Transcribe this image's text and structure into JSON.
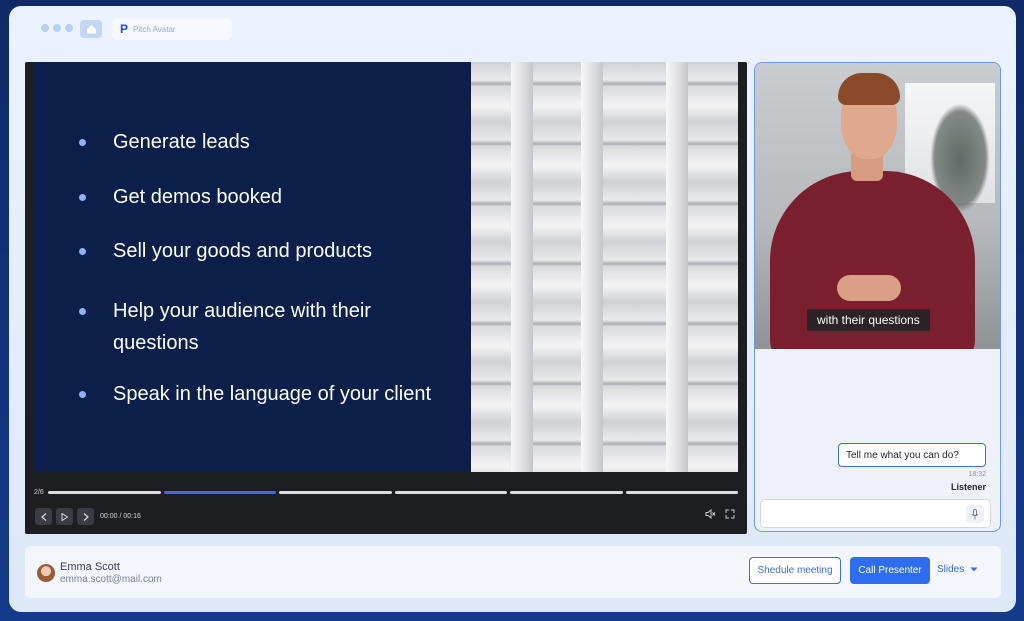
{
  "browser": {
    "address_text": "Pitch Avatar",
    "logo_glyph": "P",
    "accent_color": "#2e6cf0"
  },
  "slide": {
    "bullets": [
      "Generate leads",
      "Get demos booked",
      "Sell your goods and products",
      "Help your audience with their questions",
      "Speak in the language of your client"
    ],
    "page_indicator": "2/6",
    "segments_total": 6,
    "segment_active": 2
  },
  "player": {
    "time": "00:00 / 00:16",
    "icons": [
      "chevron-left-icon",
      "play-icon",
      "chevron-right-icon",
      "mute-icon",
      "fullscreen-icon"
    ]
  },
  "presenter": {
    "caption": "with their questions",
    "chat_message": "Tell me what you can do?",
    "chat_time": "18:32",
    "chat_user": "Listener",
    "input_placeholder": "",
    "mic_icon": "mic-icon"
  },
  "footer": {
    "user_name": "Emma Scott",
    "user_email": "emma.scott@mail.com",
    "schedule_label": "Shedule meeting",
    "call_label": "Call Presenter",
    "slides_label": "Slides"
  }
}
